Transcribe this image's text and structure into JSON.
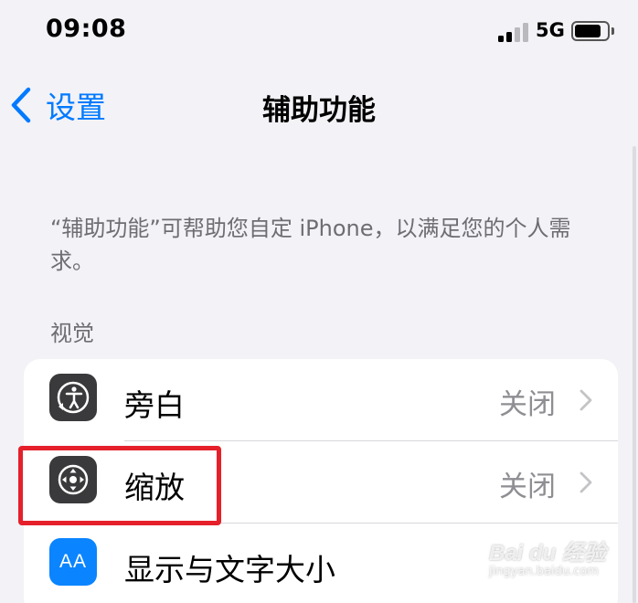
{
  "status_bar": {
    "time": "09:08",
    "network": "5G"
  },
  "nav": {
    "back_label": "设置",
    "title": "辅助功能"
  },
  "description": "“辅助功能”可帮助您自定 iPhone，以满足您的个人需求。",
  "section": {
    "header": "视觉"
  },
  "rows": [
    {
      "label": "旁白",
      "value": "关闭",
      "icon": "voiceover-icon"
    },
    {
      "label": "缩放",
      "value": "关闭",
      "icon": "zoom-icon"
    },
    {
      "label": "显示与文字大小",
      "value": "",
      "icon": "text-size-icon",
      "icon_text": "AA"
    }
  ],
  "watermark": {
    "logo": "Bai du 经验",
    "url": "jingyan.baidu.com"
  },
  "colors": {
    "accent": "#007aff",
    "highlight": "#e5202a",
    "background": "#f2f2f7"
  }
}
